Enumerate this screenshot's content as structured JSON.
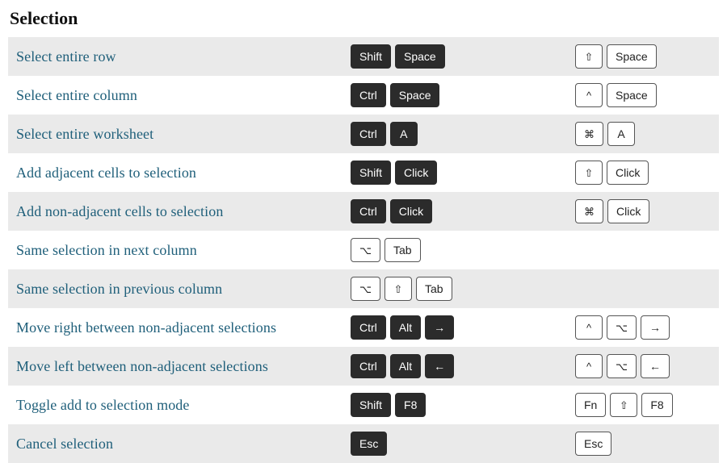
{
  "heading": "Selection",
  "rows": [
    {
      "desc": "Select entire row",
      "win": [
        {
          "t": "Shift",
          "v": "dark"
        },
        {
          "t": "Space",
          "v": "dark"
        }
      ],
      "mac": [
        {
          "t": "⇧",
          "v": "light sym"
        },
        {
          "t": "Space",
          "v": "light"
        }
      ]
    },
    {
      "desc": "Select entire column",
      "win": [
        {
          "t": "Ctrl",
          "v": "dark"
        },
        {
          "t": "Space",
          "v": "dark"
        }
      ],
      "mac": [
        {
          "t": "^",
          "v": "light sym"
        },
        {
          "t": "Space",
          "v": "light"
        }
      ]
    },
    {
      "desc": "Select entire worksheet",
      "win": [
        {
          "t": "Ctrl",
          "v": "dark"
        },
        {
          "t": "A",
          "v": "dark"
        }
      ],
      "mac": [
        {
          "t": "⌘",
          "v": "light sym"
        },
        {
          "t": "A",
          "v": "light"
        }
      ]
    },
    {
      "desc": "Add adjacent cells to selection",
      "win": [
        {
          "t": "Shift",
          "v": "dark"
        },
        {
          "t": "Click",
          "v": "dark"
        }
      ],
      "mac": [
        {
          "t": "⇧",
          "v": "light sym"
        },
        {
          "t": "Click",
          "v": "light"
        }
      ]
    },
    {
      "desc": "Add non-adjacent cells to selection",
      "win": [
        {
          "t": "Ctrl",
          "v": "dark"
        },
        {
          "t": "Click",
          "v": "dark"
        }
      ],
      "mac": [
        {
          "t": "⌘",
          "v": "light sym"
        },
        {
          "t": "Click",
          "v": "light"
        }
      ]
    },
    {
      "desc": "Same selection in next column",
      "win": [
        {
          "t": "⌥",
          "v": "light sym"
        },
        {
          "t": "Tab",
          "v": "light"
        }
      ],
      "mac": []
    },
    {
      "desc": "Same selection in previous column",
      "win": [
        {
          "t": "⌥",
          "v": "light sym"
        },
        {
          "t": "⇧",
          "v": "light sym"
        },
        {
          "t": "Tab",
          "v": "light"
        }
      ],
      "mac": []
    },
    {
      "desc": "Move right between non-adjacent selections",
      "win": [
        {
          "t": "Ctrl",
          "v": "dark"
        },
        {
          "t": "Alt",
          "v": "dark"
        },
        {
          "t": "→",
          "v": "dark"
        }
      ],
      "mac": [
        {
          "t": "^",
          "v": "light sym"
        },
        {
          "t": "⌥",
          "v": "light sym"
        },
        {
          "t": "→",
          "v": "light"
        }
      ]
    },
    {
      "desc": "Move left between non-adjacent selections",
      "win": [
        {
          "t": "Ctrl",
          "v": "dark"
        },
        {
          "t": "Alt",
          "v": "dark"
        },
        {
          "t": "←",
          "v": "dark"
        }
      ],
      "mac": [
        {
          "t": "^",
          "v": "light sym"
        },
        {
          "t": "⌥",
          "v": "light sym"
        },
        {
          "t": "←",
          "v": "light"
        }
      ]
    },
    {
      "desc": "Toggle add to selection mode",
      "win": [
        {
          "t": "Shift",
          "v": "dark"
        },
        {
          "t": "F8",
          "v": "dark"
        }
      ],
      "mac": [
        {
          "t": "Fn",
          "v": "light"
        },
        {
          "t": "⇧",
          "v": "light sym"
        },
        {
          "t": "F8",
          "v": "light"
        }
      ]
    },
    {
      "desc": "Cancel selection",
      "win": [
        {
          "t": "Esc",
          "v": "dark"
        }
      ],
      "mac": [
        {
          "t": "Esc",
          "v": "light"
        }
      ]
    }
  ]
}
